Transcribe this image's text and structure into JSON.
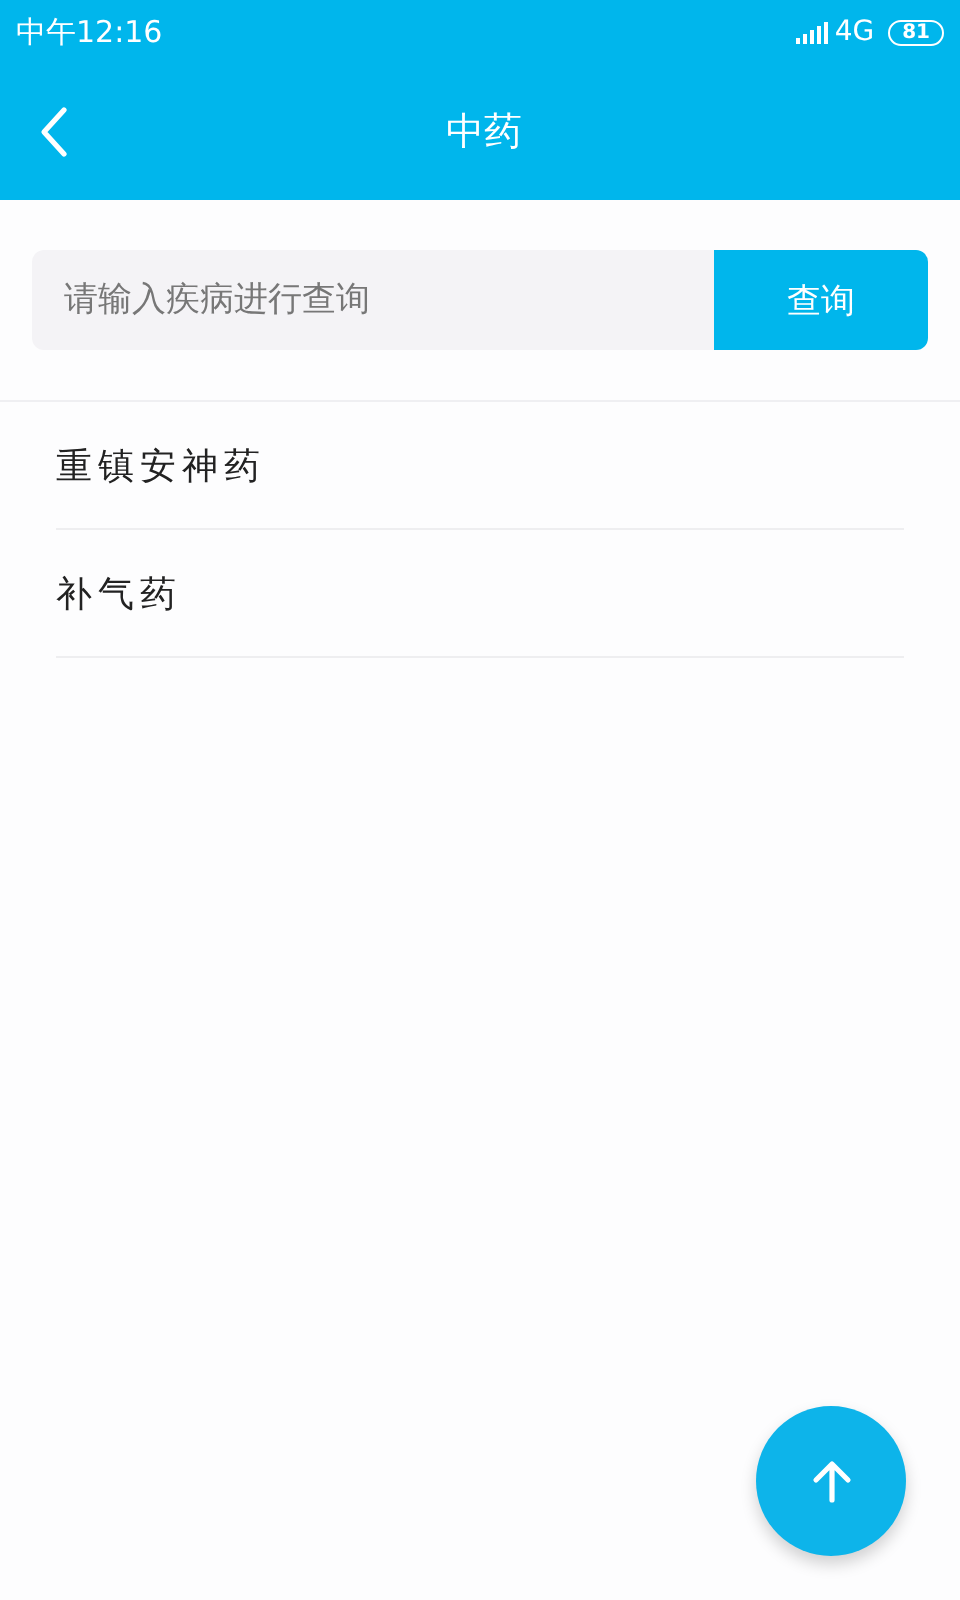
{
  "status_bar": {
    "time": "中午12:16",
    "network": "4G",
    "battery": "81"
  },
  "header": {
    "title": "中药"
  },
  "search": {
    "placeholder": "请输入疾病进行查询",
    "button": "查询"
  },
  "items": [
    {
      "label": "重镇安神药"
    },
    {
      "label": "补气药"
    }
  ]
}
